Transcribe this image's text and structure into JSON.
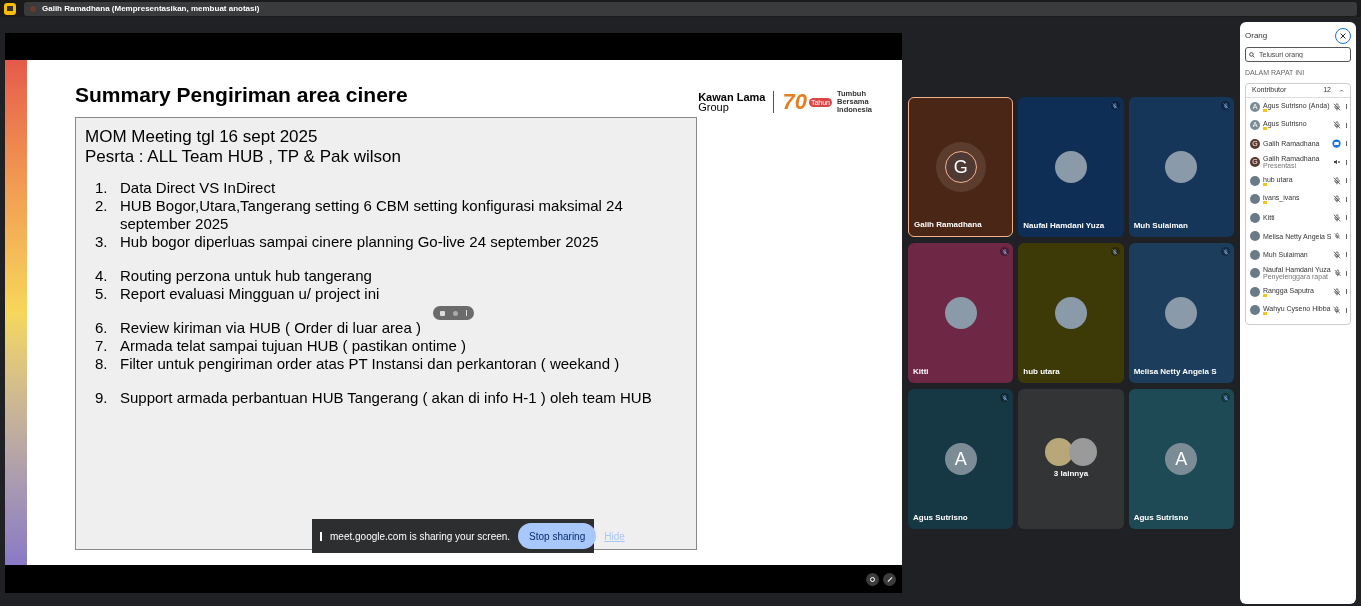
{
  "top_bar": {
    "title": "Galih Ramadhana (Mempresentasikan, membuat anotasi)"
  },
  "slide": {
    "title": "Summary Pengiriman area cinere",
    "logo": {
      "brand_line1": "Kawan Lama",
      "brand_line2": "Group",
      "number": "70",
      "badge": "Tahun",
      "tagline": [
        "Tumbuh",
        "Bersama",
        "Indonesia"
      ]
    },
    "heading_lines": [
      "MOM Meeting tgl 16 sept 2025",
      "Pesrta : ALL Team HUB , TP & Pak wilson"
    ],
    "groups": [
      [
        {
          "num": "1.",
          "text": "Data Direct VS InDirect"
        },
        {
          "num": "2.",
          "text": "HUB Bogor,Utara,Tangerang setting 6 CBM setting konfigurasi maksimal 24 september 2025"
        },
        {
          "num": "3.",
          "text": "Hub bogor diperluas sampai cinere planning Go-live 24 september 2025"
        }
      ],
      [
        {
          "num": "4.",
          "text": "Routing perzona untuk hub tangerang"
        },
        {
          "num": "5.",
          "text": "Report evaluasi Mingguan u/ project ini"
        }
      ],
      [
        {
          "num": "6.",
          "text": "Review kiriman via HUB ( Order di luar area )"
        },
        {
          "num": "7.",
          "text": "Armada telat sampai tujuan HUB ( pastikan ontime )"
        },
        {
          "num": "8.",
          "text": "Filter untuk pengiriman order atas PT Instansi dan perkantoran ( weekand )"
        }
      ],
      [
        {
          "num": "9.",
          "text": "Support armada perbantuan HUB Tangerang ( akan di info H-1 ) oleh team HUB"
        }
      ]
    ]
  },
  "share_bar": {
    "message": "meet.google.com is sharing your screen.",
    "stop_button": "Stop sharing",
    "hide_link": "Hide"
  },
  "tiles": [
    {
      "kind": "letter",
      "name": "Galih Ramadhana",
      "letter": "G",
      "color": "#4a2616",
      "selected": true,
      "muted": false
    },
    {
      "kind": "photo",
      "name": "Naufal Hamdani Yuza",
      "color": "#0f2e55",
      "selected": false,
      "muted": true
    },
    {
      "kind": "photo",
      "name": "Muh Sulaiman",
      "color": "#163659",
      "selected": false,
      "muted": true
    },
    {
      "kind": "photo",
      "name": "Kitti",
      "color": "#6e2745",
      "selected": false,
      "muted": true
    },
    {
      "kind": "photo",
      "name": "hub utara",
      "color": "#3d3a08",
      "selected": false,
      "muted": true
    },
    {
      "kind": "photo",
      "name": "Melisa Netty Angela S",
      "color": "#1c3e5c",
      "selected": false,
      "muted": true
    },
    {
      "kind": "letter",
      "name": "Agus Sutrisno",
      "letter": "A",
      "color": "#163744",
      "selected": false,
      "muted": true
    },
    {
      "kind": "others",
      "name": "3 lainnya",
      "color": "#333436",
      "selected": false,
      "muted": false
    },
    {
      "kind": "letter",
      "name": "Agus Sutrisno",
      "letter": "A",
      "color": "#1d4a55",
      "selected": false,
      "muted": true
    }
  ],
  "people_panel": {
    "title": "Orang",
    "search": {
      "placeholder": "Telusuri orang"
    },
    "section_label": "DALAM RAPAT INI",
    "group": {
      "label": "Kontributor",
      "count": "12",
      "expanded": true,
      "people": [
        {
          "name": "Agus Sutrisno (Anda)",
          "avatar": {
            "kind": "letter",
            "letter": "A"
          },
          "external": true,
          "status_icon": {
            "kind": "muted"
          }
        },
        {
          "name": "Agus Sutrisno",
          "avatar": {
            "kind": "letter",
            "letter": "A"
          },
          "external": true,
          "status_icon": {
            "kind": "muted"
          }
        },
        {
          "name": "Galih Ramadhana",
          "avatar": {
            "kind": "letter",
            "letter": "G"
          },
          "external": false,
          "status_icon": {
            "kind": "presenting"
          }
        },
        {
          "name": "Galih Ramadhana",
          "subtitle": "Presentasi",
          "avatar": {
            "kind": "letter",
            "letter": "G"
          },
          "external": false,
          "status_icon": {
            "kind": "audio-off"
          }
        },
        {
          "name": "hub utara",
          "avatar": {
            "kind": "photo"
          },
          "external": true,
          "status_icon": {
            "kind": "muted"
          }
        },
        {
          "name": "ivans_ivans",
          "avatar": {
            "kind": "photo"
          },
          "external": true,
          "status_icon": {
            "kind": "muted"
          }
        },
        {
          "name": "Kitti",
          "avatar": {
            "kind": "photo"
          },
          "external": false,
          "status_icon": {
            "kind": "muted"
          }
        },
        {
          "name": "Melisa Netty Angela S",
          "avatar": {
            "kind": "photo"
          },
          "external": false,
          "status_icon": {
            "kind": "muted"
          }
        },
        {
          "name": "Muh Sulaiman",
          "avatar": {
            "kind": "photo"
          },
          "external": false,
          "status_icon": {
            "kind": "muted"
          }
        },
        {
          "name": "Naufal Hamdani Yuza",
          "subtitle": "Penyelenggara rapat",
          "avatar": {
            "kind": "photo"
          },
          "external": false,
          "status_icon": {
            "kind": "muted"
          }
        },
        {
          "name": "Rangga Saputra",
          "avatar": {
            "kind": "photo"
          },
          "external": true,
          "status_icon": {
            "kind": "muted"
          }
        },
        {
          "name": "Wahyu Cyseno Hibba",
          "avatar": {
            "kind": "photo"
          },
          "external": true,
          "status_icon": {
            "kind": "muted"
          }
        }
      ]
    }
  }
}
